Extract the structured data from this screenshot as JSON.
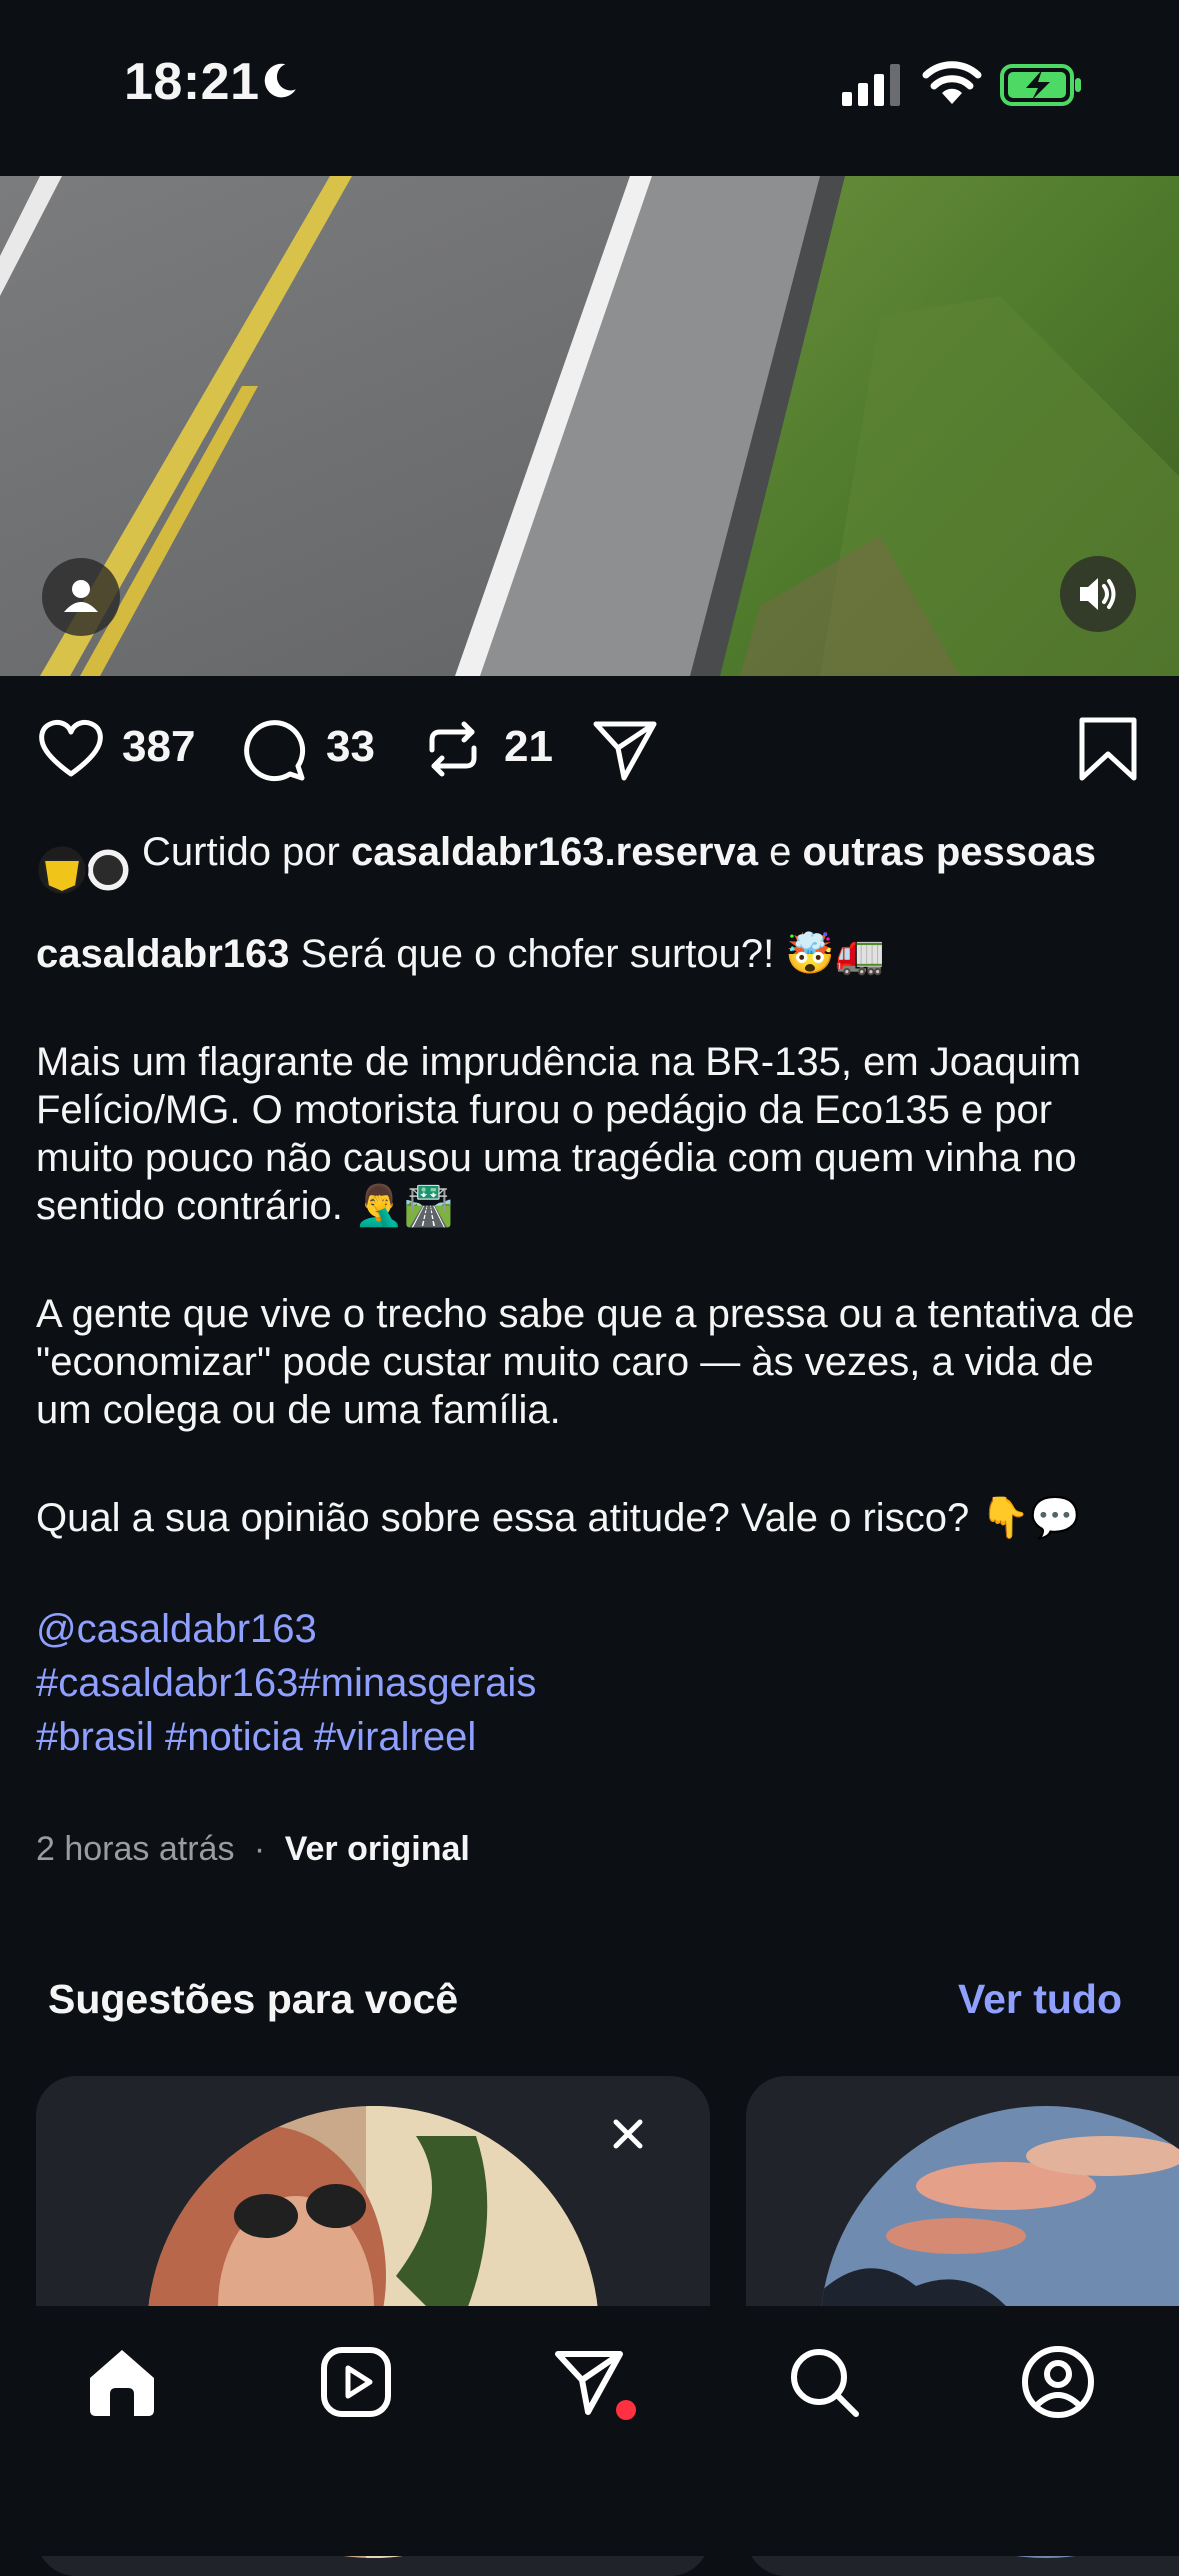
{
  "status_bar": {
    "time": "18:21"
  },
  "post": {
    "actions": {
      "likes": "387",
      "comments": "33",
      "reposts": "21"
    },
    "liked_by": {
      "prefix": "Curtido por",
      "user": "casaldabr163.reserva",
      "conjunction": "e",
      "others": "outras pessoas"
    },
    "caption": {
      "username": "casaldabr163",
      "headline": "Será que o chofer surtou?! 🤯🚛",
      "paragraph_1": "Mais um flagrante de imprudência na BR-135, em Joaquim Felício/MG. O motorista furou o pedágio da Eco135 e por muito pouco não causou uma tragédia com quem vinha no sentido contrário. 🤦‍♂️🛣️",
      "paragraph_2": "A gente que vive o trecho sabe que a pressa ou a tentativa de \"economizar\" pode custar muito caro — às vezes, a vida de um colega ou de uma família.",
      "paragraph_3": "Qual a sua opinião sobre essa atitude? Vale o risco? 👇💬",
      "mention": "@casaldabr163",
      "hashtags_line_1": "#casaldabr163#minasgerais",
      "hashtags_line_2": "#brasil #noticia #viralreel"
    },
    "meta": {
      "time_ago": "2 horas atrás",
      "separator": "·",
      "see_original": "Ver original"
    }
  },
  "suggestions": {
    "title": "Sugestões para você",
    "see_all": "Ver tudo"
  },
  "icons": {
    "status": [
      "moon-icon",
      "signal-icon",
      "wifi-icon",
      "battery-charging-icon"
    ],
    "video": [
      "user-tag-icon",
      "speaker-icon"
    ],
    "actions": [
      "heart-icon",
      "comment-icon",
      "repost-icon",
      "send-icon",
      "bookmark-icon"
    ],
    "nav": [
      "home-icon",
      "reels-icon",
      "direct-icon",
      "search-icon",
      "profile-icon"
    ]
  },
  "colors": {
    "background": "#0c0f14",
    "link": "#8fa0ff",
    "battery": "#4cd964",
    "notification_dot": "#ff3040",
    "card": "#202329"
  }
}
